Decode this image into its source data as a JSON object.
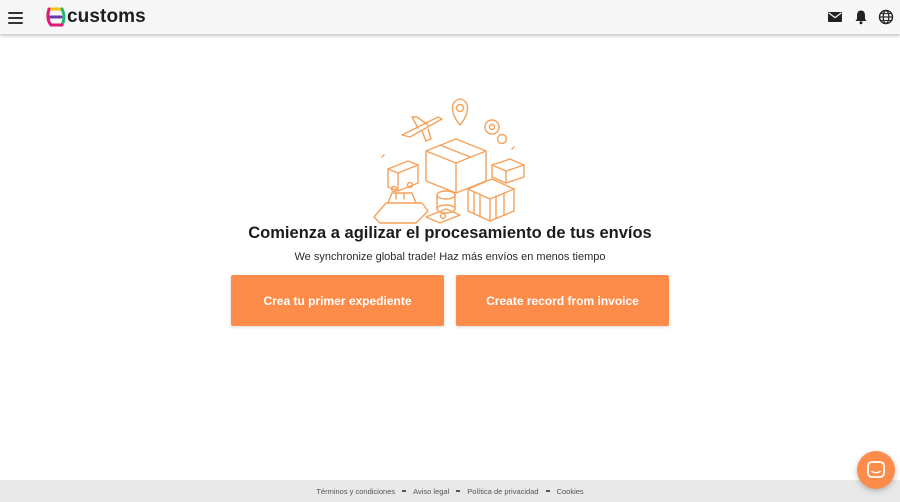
{
  "header": {
    "logo_text": "customs",
    "logo_glyph": "e",
    "icons": [
      "menu-icon",
      "mail-icon",
      "bell-icon",
      "globe-icon"
    ]
  },
  "main": {
    "headline": "Comienza a agilizar el procesamiento de tus envíos",
    "subline": "We synchronize global trade! Haz más envíos en menos tiempo",
    "primary_button": "Crea tu primer expediente",
    "secondary_button": "Create record from invoice",
    "illustration": "logistics-illustration"
  },
  "footer": {
    "links": [
      "Términos y condiciones",
      "Aviso legal",
      "Política de privacidad",
      "Cookies"
    ]
  },
  "chat": {
    "icon": "chat-icon"
  },
  "colors": {
    "accent": "#fd8c4a",
    "illustration_stroke": "#f6a15a",
    "logo_magenta": "#e0197d",
    "logo_yellow": "#f7c20f",
    "logo_green": "#22b573",
    "logo_purple": "#6c3aa8"
  }
}
